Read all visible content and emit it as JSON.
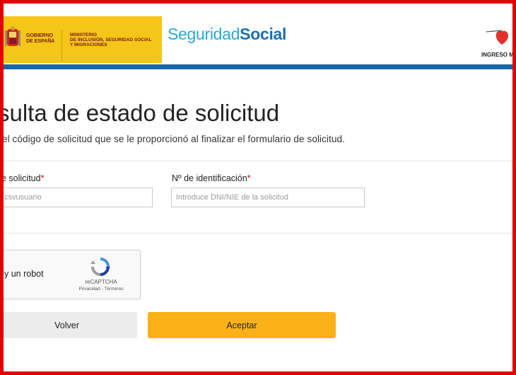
{
  "header": {
    "gov_line1": "GOBIERNO",
    "gov_line2": "DE ESPAÑA",
    "ministry_line1": "MINISTERIO",
    "ministry_line2": "DE INCLUSIÓN, SEGURIDAD SOCIAL",
    "ministry_line3": "Y MIGRACIONES",
    "logo_light": "Seguridad",
    "logo_bold": "Social",
    "imv_label": "INGRESO M"
  },
  "page": {
    "title": "sulta de estado de solicitud",
    "subtitle": "el código de solicitud que se le proporcionó al finalizar el formulario de solicitud."
  },
  "form": {
    "code_label": "e solicitud",
    "code_required": "*",
    "code_placeholder": "csvusuario",
    "id_label": "Nº de identificación",
    "id_required": "*",
    "id_placeholder": "Introduce DNI/NIE de la solicitud"
  },
  "captcha": {
    "label": "y un robot",
    "brand": "reCAPTCHA",
    "links": "Privacidad - Términos"
  },
  "buttons": {
    "back": "Volver",
    "accept": "Aceptar"
  },
  "colors": {
    "frame": "#e30000",
    "gov_yellow": "#f5c518",
    "brand_blue": "#1867a8",
    "accept": "#fbb117"
  }
}
